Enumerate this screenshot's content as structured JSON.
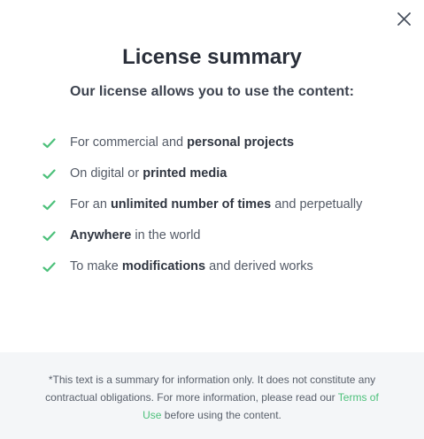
{
  "modal": {
    "title": "License summary",
    "subtitle": "Our license allows you to use the content:"
  },
  "icons": {
    "close": "close-icon",
    "check": "checkmark-icon",
    "check_color": "#4cc07a"
  },
  "items": [
    {
      "parts": [
        {
          "t": "For commercial and "
        },
        {
          "t": "personal projects",
          "b": true
        }
      ]
    },
    {
      "parts": [
        {
          "t": "On digital or "
        },
        {
          "t": "printed media",
          "b": true
        }
      ]
    },
    {
      "parts": [
        {
          "t": "For an "
        },
        {
          "t": "unlimited number of times",
          "b": true
        },
        {
          "t": " and perpetually"
        }
      ]
    },
    {
      "parts": [
        {
          "t": "Anywhere",
          "b": true
        },
        {
          "t": " in the world"
        }
      ]
    },
    {
      "parts": [
        {
          "t": "To make "
        },
        {
          "t": "modifications",
          "b": true
        },
        {
          "t": " and derived works"
        }
      ]
    }
  ],
  "footer": {
    "text_before": "*This text is a summary for information only. It does not constitute any contractual obligations. For more information, please read our ",
    "link_label": "Terms of Use",
    "text_after": " before using the content."
  }
}
